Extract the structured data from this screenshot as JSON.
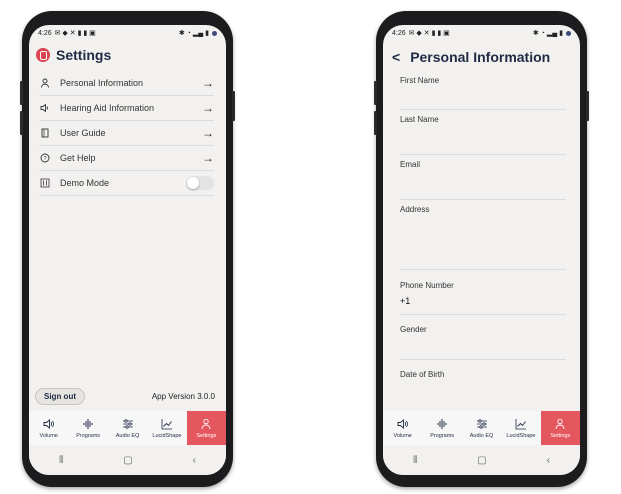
{
  "status": {
    "time": "4:26"
  },
  "settings": {
    "title": "Settings",
    "items": [
      {
        "label": "Personal Information",
        "icon": "person-icon"
      },
      {
        "label": "Hearing Aid Information",
        "icon": "speaker-icon"
      },
      {
        "label": "User Guide",
        "icon": "book-icon"
      },
      {
        "label": "Get Help",
        "icon": "help-icon"
      },
      {
        "label": "Demo Mode",
        "icon": "sliders-icon",
        "toggle": false
      }
    ],
    "sign_out": "Sign out",
    "app_version": "App Version 3.0.0"
  },
  "tabs": [
    {
      "label": "Volume",
      "icon": "volume-icon"
    },
    {
      "label": "Programs",
      "icon": "programs-icon"
    },
    {
      "label": "Audio EQ",
      "icon": "eq-icon"
    },
    {
      "label": "LucidShape",
      "icon": "chart-icon"
    },
    {
      "label": "Settings",
      "icon": "person-icon"
    }
  ],
  "active_tab": "Settings",
  "personal": {
    "title": "Personal Information",
    "fields": [
      {
        "label": "First Name",
        "value": ""
      },
      {
        "label": "Last Name",
        "value": ""
      },
      {
        "label": "Email",
        "value": ""
      },
      {
        "label": "Address",
        "value": ""
      },
      {
        "label": "Phone Number",
        "value": "+1"
      },
      {
        "label": "Gender",
        "value": ""
      },
      {
        "label": "Date of Birth",
        "value": ""
      }
    ]
  },
  "colors": {
    "accent": "#e5575f",
    "navy": "#1f2a44",
    "screen": "#f2f1ef"
  }
}
